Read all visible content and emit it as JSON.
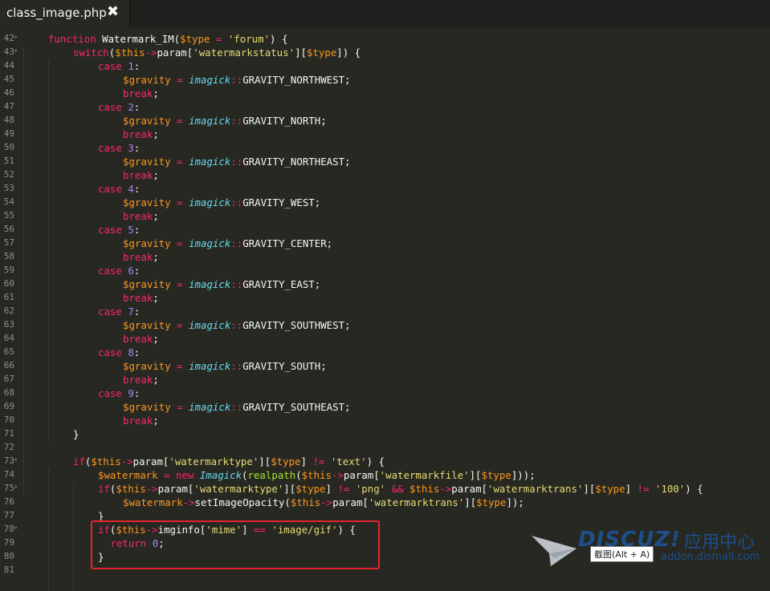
{
  "tab": {
    "title": "class_image.php",
    "close_icon": "✖"
  },
  "lines": [
    {
      "num": "42",
      "fold": true,
      "indent": 1,
      "tokens": [
        [
          "k",
          "function "
        ],
        [
          "fn",
          "Watermark_IM("
        ],
        [
          "var",
          "$type"
        ],
        [
          "k",
          " = "
        ],
        [
          "str",
          "'forum'"
        ],
        [
          "fn",
          ") {"
        ]
      ]
    },
    {
      "num": "43",
      "fold": true,
      "indent": 2,
      "tokens": [
        [
          "k",
          "switch"
        ],
        [
          "fn",
          "("
        ],
        [
          "var",
          "$this"
        ],
        [
          "k",
          "->"
        ],
        [
          "fn",
          "param["
        ],
        [
          "str",
          "'watermarkstatus'"
        ],
        [
          "fn",
          "]["
        ],
        [
          "var",
          "$type"
        ],
        [
          "fn",
          "]) {"
        ]
      ]
    },
    {
      "num": "44",
      "indent": 3,
      "tokens": [
        [
          "k",
          "case "
        ],
        [
          "num",
          "1"
        ],
        [
          "fn",
          ":"
        ]
      ]
    },
    {
      "num": "45",
      "indent": 4,
      "tokens": [
        [
          "var",
          "$gravity"
        ],
        [
          "k",
          " = "
        ],
        [
          "cls",
          "imagick"
        ],
        [
          "k",
          "::"
        ],
        [
          "fn",
          "GRAVITY_NORTHWEST;"
        ]
      ]
    },
    {
      "num": "46",
      "indent": 4,
      "tokens": [
        [
          "k",
          "break"
        ],
        [
          "fn",
          ";"
        ]
      ]
    },
    {
      "num": "47",
      "indent": 3,
      "tokens": [
        [
          "k",
          "case "
        ],
        [
          "num",
          "2"
        ],
        [
          "fn",
          ":"
        ]
      ]
    },
    {
      "num": "48",
      "indent": 4,
      "tokens": [
        [
          "var",
          "$gravity"
        ],
        [
          "k",
          " = "
        ],
        [
          "cls",
          "imagick"
        ],
        [
          "k",
          "::"
        ],
        [
          "fn",
          "GRAVITY_NORTH;"
        ]
      ]
    },
    {
      "num": "49",
      "indent": 4,
      "tokens": [
        [
          "k",
          "break"
        ],
        [
          "fn",
          ";"
        ]
      ]
    },
    {
      "num": "50",
      "indent": 3,
      "tokens": [
        [
          "k",
          "case "
        ],
        [
          "num",
          "3"
        ],
        [
          "fn",
          ":"
        ]
      ]
    },
    {
      "num": "51",
      "indent": 4,
      "tokens": [
        [
          "var",
          "$gravity"
        ],
        [
          "k",
          " = "
        ],
        [
          "cls",
          "imagick"
        ],
        [
          "k",
          "::"
        ],
        [
          "fn",
          "GRAVITY_NORTHEAST;"
        ]
      ]
    },
    {
      "num": "52",
      "indent": 4,
      "tokens": [
        [
          "k",
          "break"
        ],
        [
          "fn",
          ";"
        ]
      ]
    },
    {
      "num": "53",
      "indent": 3,
      "tokens": [
        [
          "k",
          "case "
        ],
        [
          "num",
          "4"
        ],
        [
          "fn",
          ":"
        ]
      ]
    },
    {
      "num": "54",
      "indent": 4,
      "tokens": [
        [
          "var",
          "$gravity"
        ],
        [
          "k",
          " = "
        ],
        [
          "cls",
          "imagick"
        ],
        [
          "k",
          "::"
        ],
        [
          "fn",
          "GRAVITY_WEST;"
        ]
      ]
    },
    {
      "num": "55",
      "indent": 4,
      "tokens": [
        [
          "k",
          "break"
        ],
        [
          "fn",
          ";"
        ]
      ]
    },
    {
      "num": "56",
      "indent": 3,
      "tokens": [
        [
          "k",
          "case "
        ],
        [
          "num",
          "5"
        ],
        [
          "fn",
          ":"
        ]
      ]
    },
    {
      "num": "57",
      "indent": 4,
      "tokens": [
        [
          "var",
          "$gravity"
        ],
        [
          "k",
          " = "
        ],
        [
          "cls",
          "imagick"
        ],
        [
          "k",
          "::"
        ],
        [
          "fn",
          "GRAVITY_CENTER;"
        ]
      ]
    },
    {
      "num": "58",
      "indent": 4,
      "tokens": [
        [
          "k",
          "break"
        ],
        [
          "fn",
          ";"
        ]
      ]
    },
    {
      "num": "59",
      "indent": 3,
      "tokens": [
        [
          "k",
          "case "
        ],
        [
          "num",
          "6"
        ],
        [
          "fn",
          ":"
        ]
      ]
    },
    {
      "num": "60",
      "indent": 4,
      "tokens": [
        [
          "var",
          "$gravity"
        ],
        [
          "k",
          " = "
        ],
        [
          "cls",
          "imagick"
        ],
        [
          "k",
          "::"
        ],
        [
          "fn",
          "GRAVITY_EAST;"
        ]
      ]
    },
    {
      "num": "61",
      "indent": 4,
      "tokens": [
        [
          "k",
          "break"
        ],
        [
          "fn",
          ";"
        ]
      ]
    },
    {
      "num": "62",
      "indent": 3,
      "tokens": [
        [
          "k",
          "case "
        ],
        [
          "num",
          "7"
        ],
        [
          "fn",
          ":"
        ]
      ]
    },
    {
      "num": "63",
      "indent": 4,
      "tokens": [
        [
          "var",
          "$gravity"
        ],
        [
          "k",
          " = "
        ],
        [
          "cls",
          "imagick"
        ],
        [
          "k",
          "::"
        ],
        [
          "fn",
          "GRAVITY_SOUTHWEST;"
        ]
      ]
    },
    {
      "num": "64",
      "indent": 4,
      "tokens": [
        [
          "k",
          "break"
        ],
        [
          "fn",
          ";"
        ]
      ]
    },
    {
      "num": "65",
      "indent": 3,
      "tokens": [
        [
          "k",
          "case "
        ],
        [
          "num",
          "8"
        ],
        [
          "fn",
          ":"
        ]
      ]
    },
    {
      "num": "66",
      "indent": 4,
      "tokens": [
        [
          "var",
          "$gravity"
        ],
        [
          "k",
          " = "
        ],
        [
          "cls",
          "imagick"
        ],
        [
          "k",
          "::"
        ],
        [
          "fn",
          "GRAVITY_SOUTH;"
        ]
      ]
    },
    {
      "num": "67",
      "indent": 4,
      "tokens": [
        [
          "k",
          "break"
        ],
        [
          "fn",
          ";"
        ]
      ]
    },
    {
      "num": "68",
      "indent": 3,
      "tokens": [
        [
          "k",
          "case "
        ],
        [
          "num",
          "9"
        ],
        [
          "fn",
          ":"
        ]
      ]
    },
    {
      "num": "69",
      "indent": 4,
      "tokens": [
        [
          "var",
          "$gravity"
        ],
        [
          "k",
          " = "
        ],
        [
          "cls",
          "imagick"
        ],
        [
          "k",
          "::"
        ],
        [
          "fn",
          "GRAVITY_SOUTHEAST;"
        ]
      ]
    },
    {
      "num": "70",
      "indent": 4,
      "tokens": [
        [
          "k",
          "break"
        ],
        [
          "fn",
          ";"
        ]
      ]
    },
    {
      "num": "71",
      "indent": 2,
      "tokens": [
        [
          "fn",
          "}"
        ]
      ]
    },
    {
      "num": "72",
      "indent": 0,
      "tokens": []
    },
    {
      "num": "73",
      "fold": true,
      "indent": 2,
      "tokens": [
        [
          "k",
          "if"
        ],
        [
          "fn",
          "("
        ],
        [
          "var",
          "$this"
        ],
        [
          "k",
          "->"
        ],
        [
          "fn",
          "param["
        ],
        [
          "str",
          "'watermarktype'"
        ],
        [
          "fn",
          "]["
        ],
        [
          "var",
          "$type"
        ],
        [
          "fn",
          "] "
        ],
        [
          "k",
          "!="
        ],
        [
          "fn",
          " "
        ],
        [
          "str",
          "'text'"
        ],
        [
          "fn",
          ") {"
        ]
      ]
    },
    {
      "num": "74",
      "indent": 3,
      "tokens": [
        [
          "var",
          "$watermark"
        ],
        [
          "k",
          " = new "
        ],
        [
          "cls",
          "Imagick"
        ],
        [
          "fn",
          "("
        ],
        [
          "v",
          "realpath"
        ],
        [
          "fn",
          "("
        ],
        [
          "var",
          "$this"
        ],
        [
          "k",
          "->"
        ],
        [
          "fn",
          "param["
        ],
        [
          "str",
          "'watermarkfile'"
        ],
        [
          "fn",
          "]["
        ],
        [
          "var",
          "$type"
        ],
        [
          "fn",
          "]));"
        ]
      ]
    },
    {
      "num": "75",
      "fold": true,
      "indent": 3,
      "tokens": [
        [
          "k",
          "if"
        ],
        [
          "fn",
          "("
        ],
        [
          "var",
          "$this"
        ],
        [
          "k",
          "->"
        ],
        [
          "fn",
          "param["
        ],
        [
          "str",
          "'watermarktype'"
        ],
        [
          "fn",
          "]["
        ],
        [
          "var",
          "$type"
        ],
        [
          "fn",
          "] "
        ],
        [
          "k",
          "!="
        ],
        [
          "fn",
          " "
        ],
        [
          "str",
          "'png'"
        ],
        [
          "fn",
          " "
        ],
        [
          "k",
          "&&"
        ],
        [
          "fn",
          " "
        ],
        [
          "var",
          "$this"
        ],
        [
          "k",
          "->"
        ],
        [
          "fn",
          "param["
        ],
        [
          "str",
          "'watermarktrans'"
        ],
        [
          "fn",
          "]["
        ],
        [
          "var",
          "$type"
        ],
        [
          "fn",
          "] "
        ],
        [
          "k",
          "!="
        ],
        [
          "fn",
          " "
        ],
        [
          "str",
          "'100'"
        ],
        [
          "fn",
          ") {"
        ]
      ]
    },
    {
      "num": "76",
      "indent": 4,
      "tokens": [
        [
          "var",
          "$watermark"
        ],
        [
          "k",
          "->"
        ],
        [
          "fn",
          "setImageOpacity("
        ],
        [
          "var",
          "$this"
        ],
        [
          "k",
          "->"
        ],
        [
          "fn",
          "param["
        ],
        [
          "str",
          "'watermarktrans'"
        ],
        [
          "fn",
          "]["
        ],
        [
          "var",
          "$type"
        ],
        [
          "fn",
          "]);"
        ]
      ]
    },
    {
      "num": "77",
      "indent": 3,
      "tokens": [
        [
          "fn",
          "}"
        ]
      ]
    },
    {
      "num": "78",
      "fold": true,
      "indent": 3,
      "tokens": [
        [
          "k",
          "if"
        ],
        [
          "fn",
          "("
        ],
        [
          "var",
          "$this"
        ],
        [
          "k",
          "->"
        ],
        [
          "fn",
          "imginfo["
        ],
        [
          "str",
          "'mime'"
        ],
        [
          "fn",
          "] "
        ],
        [
          "k",
          "=="
        ],
        [
          "fn",
          " "
        ],
        [
          "str",
          "'image/gif'"
        ],
        [
          "fn",
          ") {"
        ]
      ]
    },
    {
      "num": "79",
      "indent": 3.5,
      "tokens": [
        [
          "k",
          "return "
        ],
        [
          "num",
          "0"
        ],
        [
          "fn",
          ";"
        ]
      ]
    },
    {
      "num": "80",
      "indent": 3,
      "tokens": [
        [
          "fn",
          "}"
        ]
      ]
    },
    {
      "num": "81",
      "indent": 0,
      "tokens": []
    }
  ],
  "watermark": {
    "logo": "DISCUZ!",
    "cn": "应用中心",
    "url": "addon.dismall.com"
  },
  "tooltip": "截图(Alt + A)"
}
